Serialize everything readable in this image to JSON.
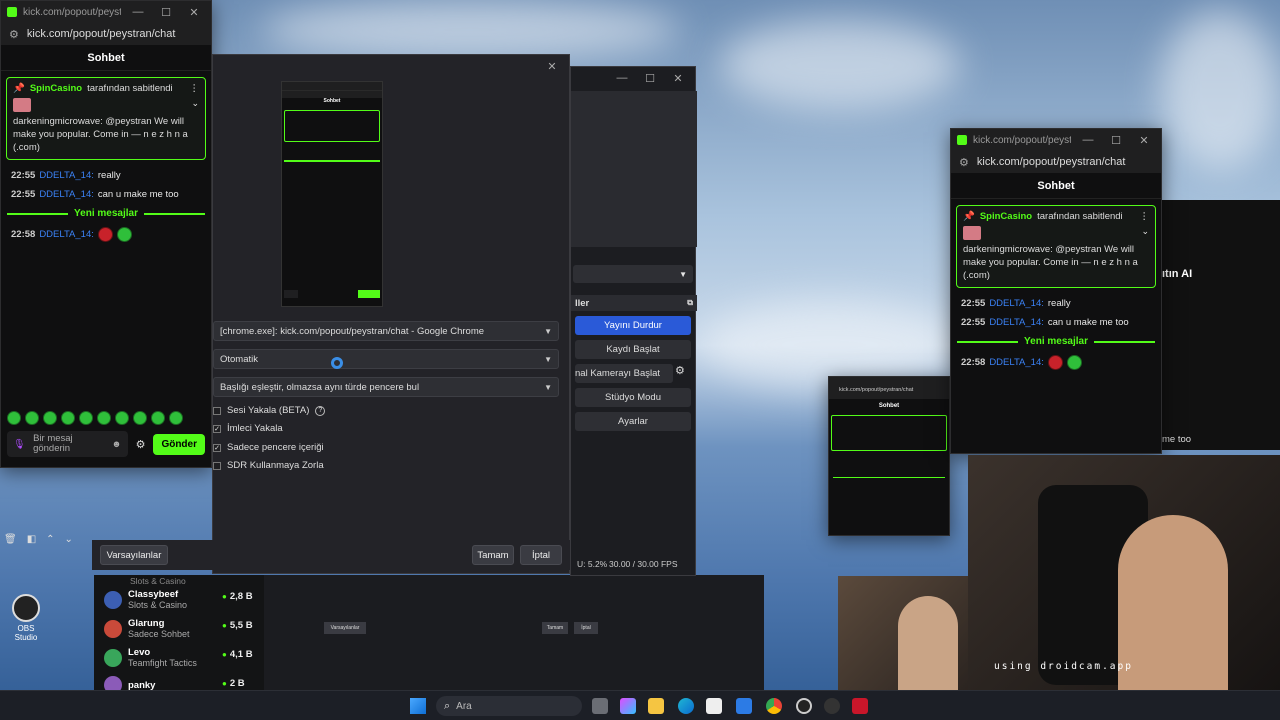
{
  "left_chat": {
    "titlebar": "kick.com/popout/peystran/...",
    "url": "kick.com/popout/peystran/chat",
    "header": "Sohbet",
    "pinned_user": "SpinCasino",
    "pinned_suffix": "tarafından sabitlendi",
    "pinned_message": "darkeningmicrowave: @peystran We will make you popular. Come in — n e z h n a (.com)",
    "messages": [
      {
        "time": "22:55",
        "user": "DDELTA_14:",
        "text": "really"
      },
      {
        "time": "22:55",
        "user": "DDELTA_14:",
        "text": "can u make me too"
      }
    ],
    "new_messages": "Yeni mesajlar",
    "emote_message": {
      "time": "22:58",
      "user": "DDELTA_14:"
    },
    "input_placeholder": "Bir mesaj gönderin",
    "send": "Gönder"
  },
  "obs_props": {
    "window_select": "[chrome.exe]: kick.com/popout/peystran/chat - Google Chrome",
    "capture_method": "Otomatik",
    "match_priority": "Başlığı eşleştir, olmazsa aynı türde pencere bul",
    "checkboxes": [
      {
        "label": "Sesi Yakala (BETA)",
        "checked": false
      },
      {
        "label": "İmleci Yakala",
        "checked": true
      },
      {
        "label": "Sadece pencere içeriği",
        "checked": true
      },
      {
        "label": "SDR Kullanmaya Zorla",
        "checked": false
      }
    ],
    "defaults": "Varsayılanlar",
    "ok": "Tamam",
    "cancel": "İptal"
  },
  "obs_controls": {
    "title": "ller",
    "buttons": [
      "Yayını Durdur",
      "Kaydı Başlat",
      "nal Kamerayı Başlat",
      "Stüdyo Modu",
      "Ayarlar"
    ],
    "status_cpu": "U: 5.2%",
    "status_fps": "30.00 / 30.00 FPS"
  },
  "right_chat": {
    "titlebar": "kick.com/popout/peystran/...",
    "url": "kick.com/popout/peystran/chat",
    "header": "Sohbet",
    "pinned_user": "SpinCasino",
    "pinned_suffix": "tarafından sabitlendi",
    "pinned_message": "darkeningmicrowave: @peystran We will make you popular. Come in — n e z h n a (.com)",
    "messages": [
      {
        "time": "22:55",
        "user": "DDELTA_14:",
        "text": "really"
      },
      {
        "time": "22:55",
        "user": "DDELTA_14:",
        "text": "can u make me too"
      }
    ],
    "new_messages": "Yeni mesajlar",
    "emote_message": {
      "time": "22:58",
      "user": "DDELTA_14:"
    },
    "behind_text": "me too",
    "behind_pill": "ıtın AI"
  },
  "kick_sidebar": {
    "top_category": "Slots & Casino",
    "items": [
      {
        "name": "Classybeef",
        "category": "Slots & Casino",
        "viewers": "2,8 B",
        "color": "#3c5fb3"
      },
      {
        "name": "Glarung",
        "category": "Sadece Sohbet",
        "viewers": "5,5 B",
        "color": "#c94a3a"
      },
      {
        "name": "Levo",
        "category": "Teamfight Tactics",
        "viewers": "4,1 B",
        "color": "#39a65b"
      },
      {
        "name": "panky",
        "category": "",
        "viewers": "2 B",
        "color": "#8b5bb8"
      }
    ]
  },
  "desktop": {
    "obs_icon_label": "OBS Studio"
  },
  "webcam": {
    "watermark": "using droidcam.app"
  },
  "taskbar": {
    "search": "Ara"
  },
  "colors": {
    "kick_green": "#53fc18",
    "user_blue": "#3b82f6",
    "obs_blue": "#2a5ad8"
  }
}
